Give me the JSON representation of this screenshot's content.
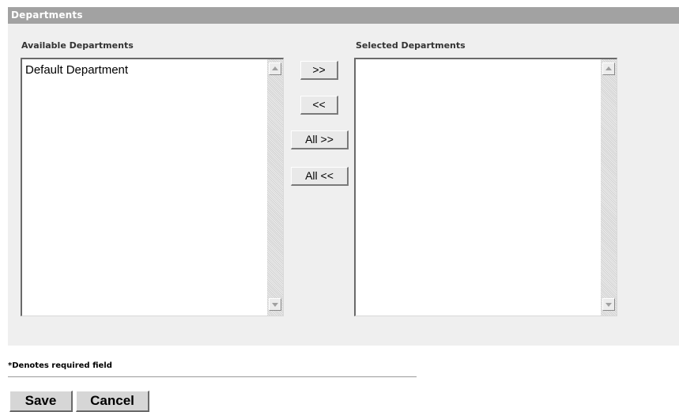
{
  "section": {
    "title": "Departments"
  },
  "available": {
    "label": "Available Departments",
    "items": [
      "Default Department"
    ]
  },
  "selected": {
    "label": "Selected Departments",
    "items": []
  },
  "move_buttons": {
    "add": ">>",
    "remove": "<<",
    "add_all": "All >>",
    "remove_all": "All <<"
  },
  "footer": {
    "required_note": "*Denotes required field",
    "save_label": "Save",
    "cancel_label": "Cancel"
  },
  "icons": {
    "scroll_up": "arrow-up-icon",
    "scroll_down": "arrow-down-icon"
  }
}
